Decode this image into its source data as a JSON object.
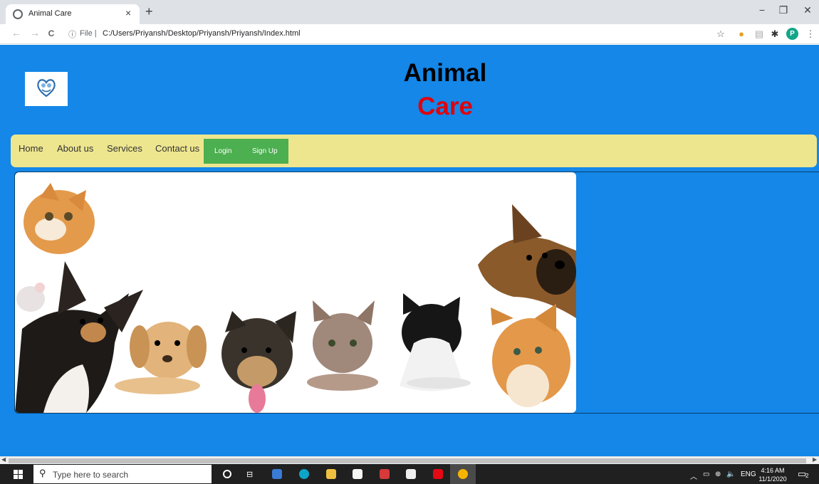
{
  "browser": {
    "tab_title": "Animal Care",
    "tab_close": "×",
    "new_tab": "+",
    "back": "←",
    "forward": "→",
    "reload": "C",
    "info_icon": "ⓘ",
    "file_label": "File |",
    "url": "C:/Users/Priyansh/Desktop/Priyansh/Priyansh/Index.html",
    "avatar_letter": "P",
    "minimize": "−",
    "maximize": "❐",
    "close": "✕"
  },
  "site": {
    "title_line1": "Animal",
    "title_line2": "Care",
    "nav": [
      "Home",
      "About us",
      "Services",
      "Contact us"
    ],
    "login_label": "Login",
    "signup_label": "Sign Up",
    "hero_alt": "Pets banner",
    "colors": {
      "page_bg": "#1487e8",
      "navbar_bg": "#eee68f",
      "button_bg": "#4caf50",
      "title_red": "#e0000b"
    }
  },
  "taskbar": {
    "search_placeholder": "Type here to search",
    "lang": "ENG",
    "time": "4:16 AM",
    "date": "11/1/2020",
    "notif_count": "2"
  }
}
